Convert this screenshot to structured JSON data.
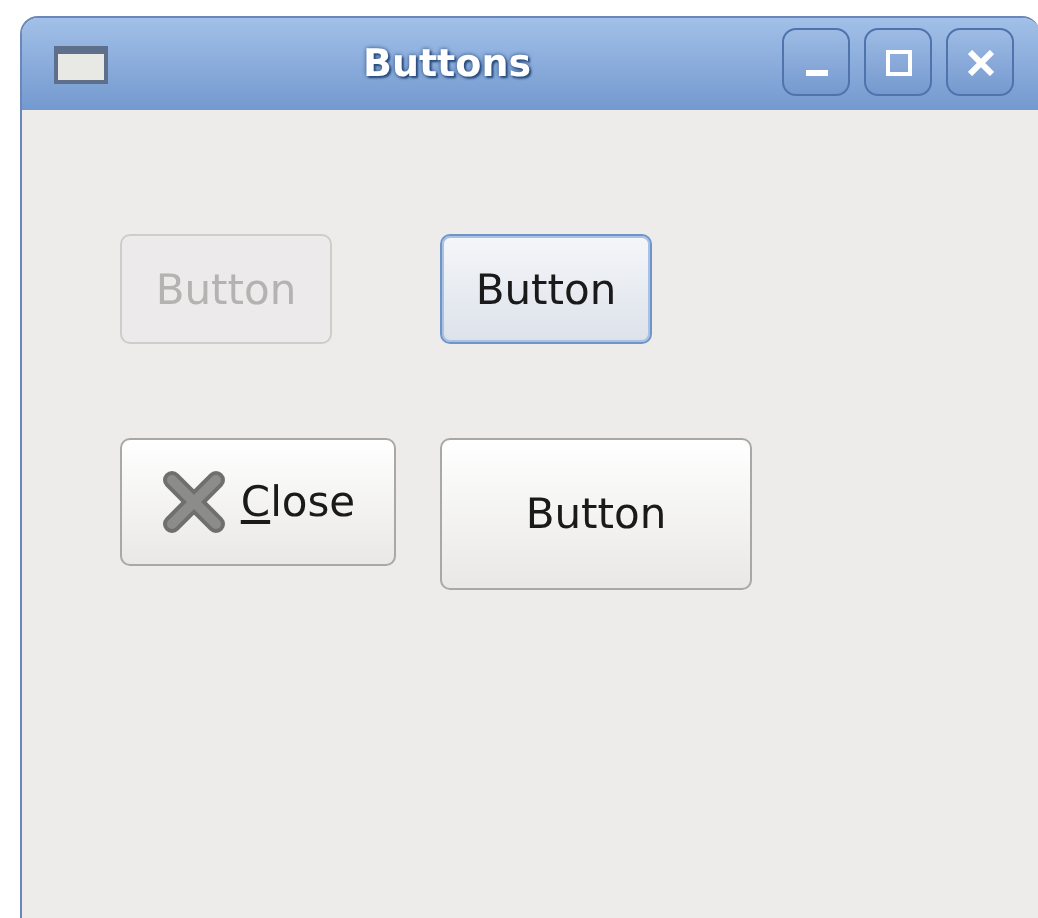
{
  "window": {
    "title": "Buttons",
    "controls": [
      {
        "kind": "minimize"
      },
      {
        "kind": "maximize"
      },
      {
        "kind": "close"
      }
    ]
  },
  "buttons": [
    {
      "kind": "text",
      "label": "Button",
      "disabled": true,
      "focused": false
    },
    {
      "kind": "text",
      "label": "Button",
      "disabled": false,
      "focused": true
    },
    {
      "kind": "stock-close",
      "label": "Close",
      "mnemonic": true,
      "disabled": false,
      "focused": false
    },
    {
      "kind": "large",
      "label": "Button",
      "disabled": false,
      "focused": false
    }
  ]
}
